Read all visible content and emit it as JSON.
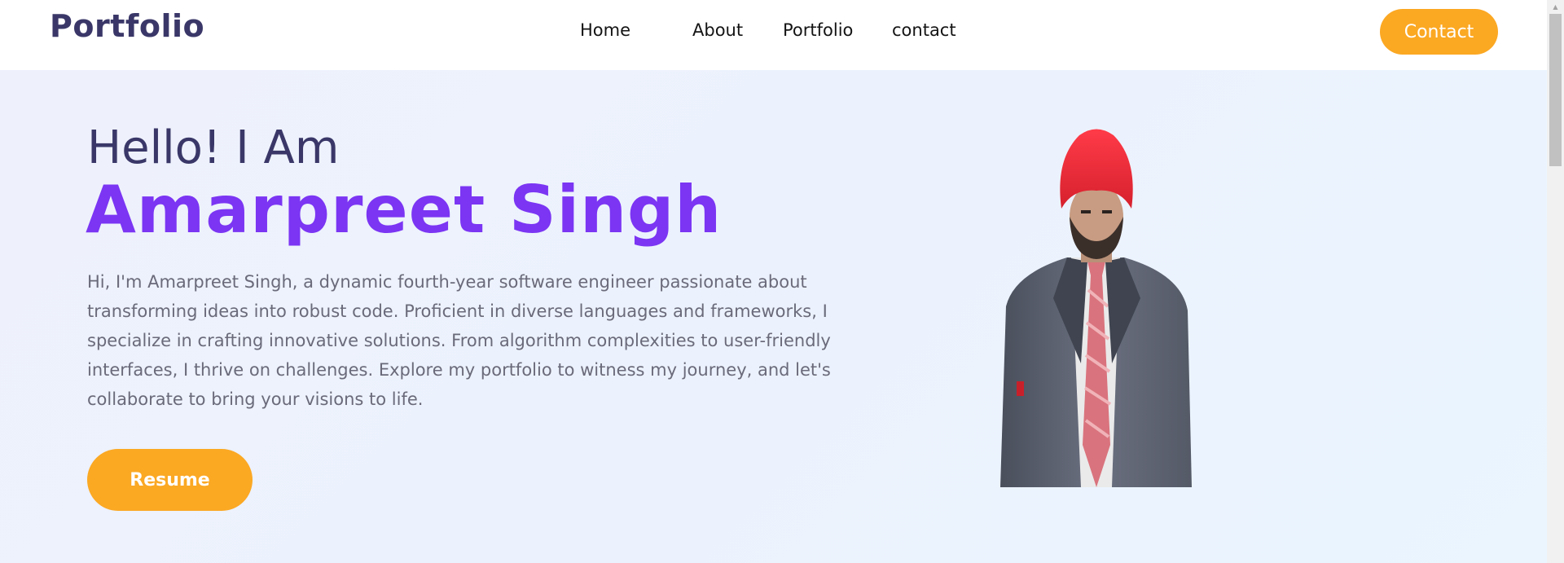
{
  "header": {
    "brand": "Portfolio",
    "nav": [
      {
        "label": "Home"
      },
      {
        "label": "About"
      },
      {
        "label": "Portfolio"
      },
      {
        "label": "contact"
      }
    ],
    "contact_button": "Contact"
  },
  "hero": {
    "greeting": "Hello! I Am",
    "name": "Amarpreet Singh",
    "bio": "Hi, I'm Amarpreet Singh, a dynamic fourth-year software engineer passionate about transforming ideas into robust code. Proficient in diverse languages and frameworks, I specialize in crafting innovative solutions. From algorithm complexities to user-friendly interfaces, I thrive on challenges. Explore my portfolio to witness my journey, and let's collaborate to bring your visions to life.",
    "resume_button": "Resume"
  },
  "colors": {
    "brand_text": "#3a3768",
    "accent_purple": "#7b35f3",
    "button_orange": "#fba823",
    "hero_bg": "#ecf2fd"
  },
  "icons": {
    "scroll_up": "chevron-up-icon"
  }
}
